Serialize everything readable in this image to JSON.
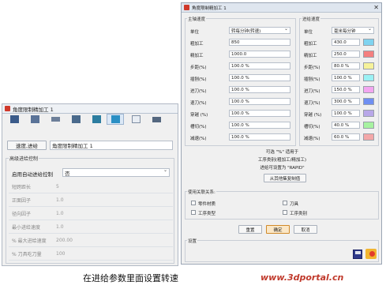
{
  "right": {
    "title": "角度限制精加工 1",
    "spindle": {
      "group": "主轴速度",
      "rows": [
        {
          "label": "单位",
          "value": "转每分钟(转速)"
        },
        {
          "label": "粗加工",
          "value": "850"
        },
        {
          "label": "精加工",
          "value": "1000.0"
        },
        {
          "label": "步距(%)",
          "value": "100.0 %"
        },
        {
          "label": "插刨(%)",
          "value": "100.0 %"
        },
        {
          "label": "进刀(%)",
          "value": "100.0 %"
        },
        {
          "label": "退刀(%)",
          "value": "100.0 %"
        },
        {
          "label": "穿越 (%)",
          "value": "100.0 %"
        },
        {
          "label": "槽切(%)",
          "value": "100.0 %"
        },
        {
          "label": "减速(%)",
          "value": "100.0 %"
        }
      ]
    },
    "feed": {
      "group": "进给速度",
      "rows": [
        {
          "label": "单位",
          "value": "毫米每分钟",
          "color": ""
        },
        {
          "label": "粗加工",
          "value": "430.0",
          "color": "#7fd3f0"
        },
        {
          "label": "精加工",
          "value": "250.0",
          "color": "#f47f7f"
        },
        {
          "label": "步距(%)",
          "value": "80.0 %",
          "color": "#f6f29a"
        },
        {
          "label": "插刨(%)",
          "value": "100.0 %",
          "color": "#9bf1f4"
        },
        {
          "label": "进刀(%)",
          "value": "150.0 %",
          "color": "#f3a6f0"
        },
        {
          "label": "退刀(%)",
          "value": "300.0 %",
          "color": "#6f8ff2"
        },
        {
          "label": "穿越 (%)",
          "value": "100.0 %",
          "color": "#b8a7e8"
        },
        {
          "label": "槽切(%)",
          "value": "40.0 %",
          "color": "#a7f2a0"
        },
        {
          "label": "减速(%)",
          "value": "60.0 %",
          "color": "#f3a8a8"
        }
      ]
    },
    "note_line1": "可选 \"%\" 适用于",
    "note_line2": "工序类别(粗加工/精加工)",
    "note_line3": "进给可设置为 \"RAPID\"",
    "copy_button": "从其他集复制值",
    "related": {
      "group": "使用关联关系:",
      "items": [
        "零件材质",
        "刀具",
        "工序类型",
        "工序类别"
      ]
    },
    "buttons": {
      "reset": "重置",
      "ok": "确定",
      "cancel": "取消"
    },
    "settings_group": "设置"
  },
  "left": {
    "title": "角度限制精加工 1",
    "speed_button": "速度,进给",
    "name_value": "角度限制精加工 1",
    "advanced_group": "高级进给控制",
    "auto_label": "启用自动进给控制",
    "auto_value": "否",
    "rows": [
      {
        "label": "短跨距长",
        "value": "5"
      },
      {
        "label": "正面因子",
        "value": "1.0"
      },
      {
        "label": "径向因子",
        "value": "1.0"
      },
      {
        "label": "最小进给速度",
        "value": "1.0"
      },
      {
        "label": "% 最大进给速度",
        "value": "200.00"
      },
      {
        "label": "% 刀具吃刀量",
        "value": "100"
      }
    ]
  },
  "caption": "在进给参数里面设置转速",
  "watermark": "www.3dportal.cn"
}
